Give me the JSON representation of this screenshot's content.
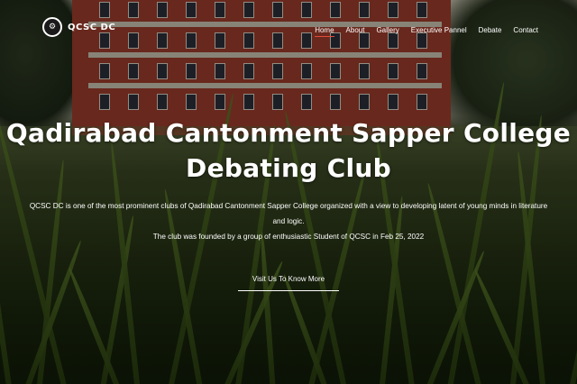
{
  "brand": {
    "logo_icon": "college-seal-icon",
    "name": "QCSC DC"
  },
  "nav": {
    "items": [
      {
        "label": "Home",
        "active": true
      },
      {
        "label": "About",
        "active": false
      },
      {
        "label": "Gallery",
        "active": false
      },
      {
        "label": "Executive Pannel",
        "active": false
      },
      {
        "label": "Debate",
        "active": false
      },
      {
        "label": "Contact",
        "active": false
      }
    ],
    "active_underline_color": "#e14b3a"
  },
  "hero": {
    "title_line1": "Qadirabad Cantonment Sapper College",
    "title_line2": "Debating Club",
    "description_line1": "QCSC DC is one of the most prominent clubs of Qadirabad Cantonment Sapper College organized with a view to developing latent of young minds in literature and logic.",
    "description_line2": "The club was founded by a group of enthusiastic Student of QCSC in Feb 25, 2022",
    "cta_label": "Visit Us To Know More"
  }
}
